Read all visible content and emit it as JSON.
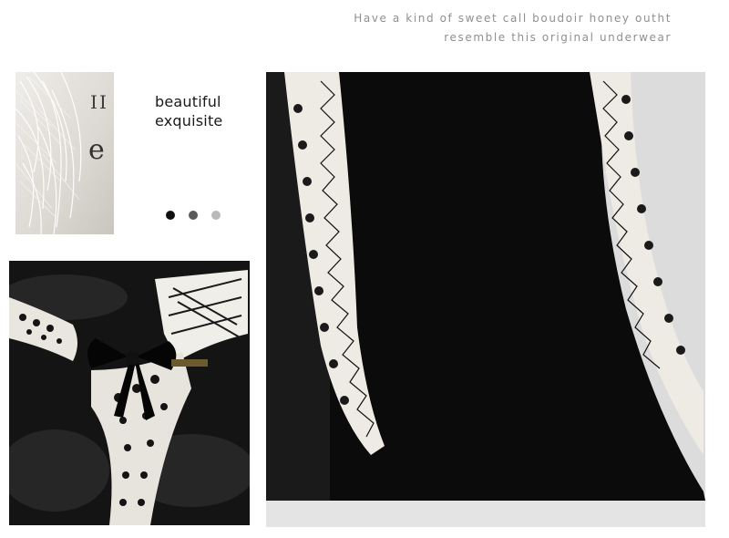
{
  "tagline": {
    "line1": "Have a kind of sweet call boudoir honey outht",
    "line2": "resemble this original underwear"
  },
  "caption": {
    "line1": "beautiful",
    "line2": "exquisite"
  },
  "dots": [
    {
      "color": "#111111"
    },
    {
      "color": "#5b5b5b"
    },
    {
      "color": "#b9b9b9"
    }
  ],
  "images": {
    "feather": "white-feather-detail-photo",
    "bow": "lace-bow-detail-photo",
    "main": "black-fabric-lace-trim-photo"
  }
}
